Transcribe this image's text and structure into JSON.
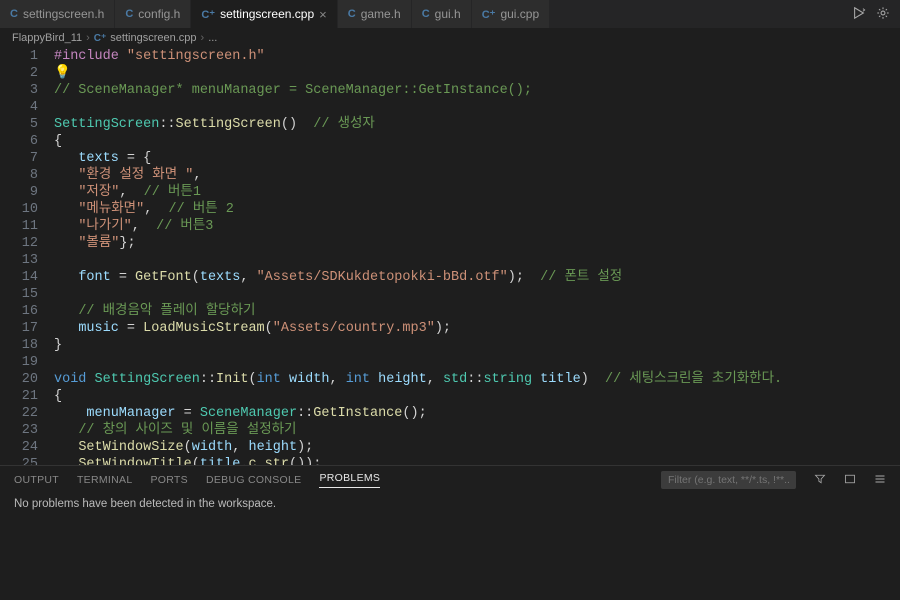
{
  "tabs": [
    {
      "icon": "C",
      "label": "settingscreen.h",
      "active": false
    },
    {
      "icon": "C",
      "label": "config.h",
      "active": false
    },
    {
      "icon": "C⁺",
      "label": "settingscreen.cpp",
      "active": true
    },
    {
      "icon": "C",
      "label": "game.h",
      "active": false
    },
    {
      "icon": "C",
      "label": "gui.h",
      "active": false
    },
    {
      "icon": "C⁺",
      "label": "gui.cpp",
      "active": false
    }
  ],
  "breadcrumb": {
    "project": "FlappyBird_11",
    "file_icon": "C⁺",
    "file": "settingscreen.cpp",
    "more": "..."
  },
  "code": {
    "lines": [
      {
        "n": 1,
        "tokens": [
          [
            "preproc",
            "#include "
          ],
          [
            "string",
            "\"settingscreen.h\""
          ]
        ]
      },
      {
        "n": 2,
        "tokens": [
          [
            "bulb",
            "💡"
          ]
        ]
      },
      {
        "n": 3,
        "tokens": [
          [
            "comment",
            "// SceneManager* menuManager = SceneManager::GetInstance();"
          ]
        ]
      },
      {
        "n": 4,
        "tokens": []
      },
      {
        "n": 5,
        "tokens": [
          [
            "type",
            "SettingScreen"
          ],
          [
            "punct",
            "::"
          ],
          [
            "func",
            "SettingScreen"
          ],
          [
            "punct",
            "()  "
          ],
          [
            "comment",
            "// 생성자"
          ]
        ]
      },
      {
        "n": 6,
        "tokens": [
          [
            "punct",
            "{"
          ]
        ]
      },
      {
        "n": 7,
        "tokens": [
          [
            "plain",
            "   "
          ],
          [
            "var",
            "texts"
          ],
          [
            "plain",
            " = "
          ],
          [
            "punct",
            "{"
          ]
        ]
      },
      {
        "n": 8,
        "tokens": [
          [
            "plain",
            "   "
          ],
          [
            "string",
            "\"환경 설정 화면 \""
          ],
          [
            "punct",
            ","
          ]
        ]
      },
      {
        "n": 9,
        "tokens": [
          [
            "plain",
            "   "
          ],
          [
            "string",
            "\"저장\""
          ],
          [
            "punct",
            ",  "
          ],
          [
            "comment",
            "// 버튼1"
          ]
        ]
      },
      {
        "n": 10,
        "tokens": [
          [
            "plain",
            "   "
          ],
          [
            "string",
            "\"메뉴화면\""
          ],
          [
            "punct",
            ",  "
          ],
          [
            "comment",
            "// 버튼 2"
          ]
        ]
      },
      {
        "n": 11,
        "tokens": [
          [
            "plain",
            "   "
          ],
          [
            "string",
            "\"나가기\""
          ],
          [
            "punct",
            ",  "
          ],
          [
            "comment",
            "// 버튼3"
          ]
        ]
      },
      {
        "n": 12,
        "tokens": [
          [
            "plain",
            "   "
          ],
          [
            "string",
            "\"볼륨\""
          ],
          [
            "punct",
            "};"
          ]
        ]
      },
      {
        "n": 13,
        "tokens": []
      },
      {
        "n": 14,
        "tokens": [
          [
            "plain",
            "   "
          ],
          [
            "var",
            "font"
          ],
          [
            "plain",
            " = "
          ],
          [
            "func",
            "GetFont"
          ],
          [
            "punct",
            "("
          ],
          [
            "var",
            "texts"
          ],
          [
            "punct",
            ", "
          ],
          [
            "string",
            "\"Assets/SDKukdetopokki-bBd.otf\""
          ],
          [
            "punct",
            ");  "
          ],
          [
            "comment",
            "// 폰트 설정"
          ]
        ]
      },
      {
        "n": 15,
        "tokens": []
      },
      {
        "n": 16,
        "tokens": [
          [
            "plain",
            "   "
          ],
          [
            "comment",
            "// 배경음악 플레이 할당하기"
          ]
        ]
      },
      {
        "n": 17,
        "tokens": [
          [
            "plain",
            "   "
          ],
          [
            "var",
            "music"
          ],
          [
            "plain",
            " = "
          ],
          [
            "func",
            "LoadMusicStream"
          ],
          [
            "punct",
            "("
          ],
          [
            "string",
            "\"Assets/country.mp3\""
          ],
          [
            "punct",
            ");"
          ]
        ]
      },
      {
        "n": 18,
        "tokens": [
          [
            "punct",
            "}"
          ]
        ]
      },
      {
        "n": 19,
        "tokens": []
      },
      {
        "n": 20,
        "tokens": [
          [
            "keyword",
            "void"
          ],
          [
            "plain",
            " "
          ],
          [
            "type",
            "SettingScreen"
          ],
          [
            "punct",
            "::"
          ],
          [
            "func",
            "Init"
          ],
          [
            "punct",
            "("
          ],
          [
            "keyword",
            "int"
          ],
          [
            "plain",
            " "
          ],
          [
            "var",
            "width"
          ],
          [
            "punct",
            ", "
          ],
          [
            "keyword",
            "int"
          ],
          [
            "plain",
            " "
          ],
          [
            "var",
            "height"
          ],
          [
            "punct",
            ", "
          ],
          [
            "namespace",
            "std"
          ],
          [
            "punct",
            "::"
          ],
          [
            "type",
            "string"
          ],
          [
            "plain",
            " "
          ],
          [
            "var",
            "title"
          ],
          [
            "punct",
            ")  "
          ],
          [
            "comment",
            "// 세팅스크린을 초기화한다."
          ]
        ]
      },
      {
        "n": 21,
        "tokens": [
          [
            "punct",
            "{"
          ]
        ]
      },
      {
        "n": 22,
        "tokens": [
          [
            "plain",
            "    "
          ],
          [
            "var",
            "menuManager"
          ],
          [
            "plain",
            " = "
          ],
          [
            "type",
            "SceneManager"
          ],
          [
            "punct",
            "::"
          ],
          [
            "func",
            "GetInstance"
          ],
          [
            "punct",
            "();"
          ]
        ]
      },
      {
        "n": 23,
        "tokens": [
          [
            "plain",
            "   "
          ],
          [
            "comment",
            "// 창의 사이즈 및 이름을 설정하기"
          ]
        ]
      },
      {
        "n": 24,
        "tokens": [
          [
            "plain",
            "   "
          ],
          [
            "func",
            "SetWindowSize"
          ],
          [
            "punct",
            "("
          ],
          [
            "var",
            "width"
          ],
          [
            "punct",
            ", "
          ],
          [
            "var",
            "height"
          ],
          [
            "punct",
            ");"
          ]
        ]
      },
      {
        "n": 25,
        "tokens": [
          [
            "plain",
            "   "
          ],
          [
            "func",
            "SetWindowTitle"
          ],
          [
            "punct",
            "("
          ],
          [
            "var",
            "title"
          ],
          [
            "punct",
            "."
          ],
          [
            "func",
            "c_str"
          ],
          [
            "punct",
            "());"
          ]
        ]
      }
    ]
  },
  "panel": {
    "tabs": {
      "output": "OUTPUT",
      "terminal": "TERMINAL",
      "ports": "PORTS",
      "debug_console": "DEBUG CONSOLE",
      "problems": "PROBLEMS"
    },
    "filter_placeholder": "Filter (e.g. text, **/*.ts, !**...",
    "message": "No problems have been detected in the workspace."
  }
}
